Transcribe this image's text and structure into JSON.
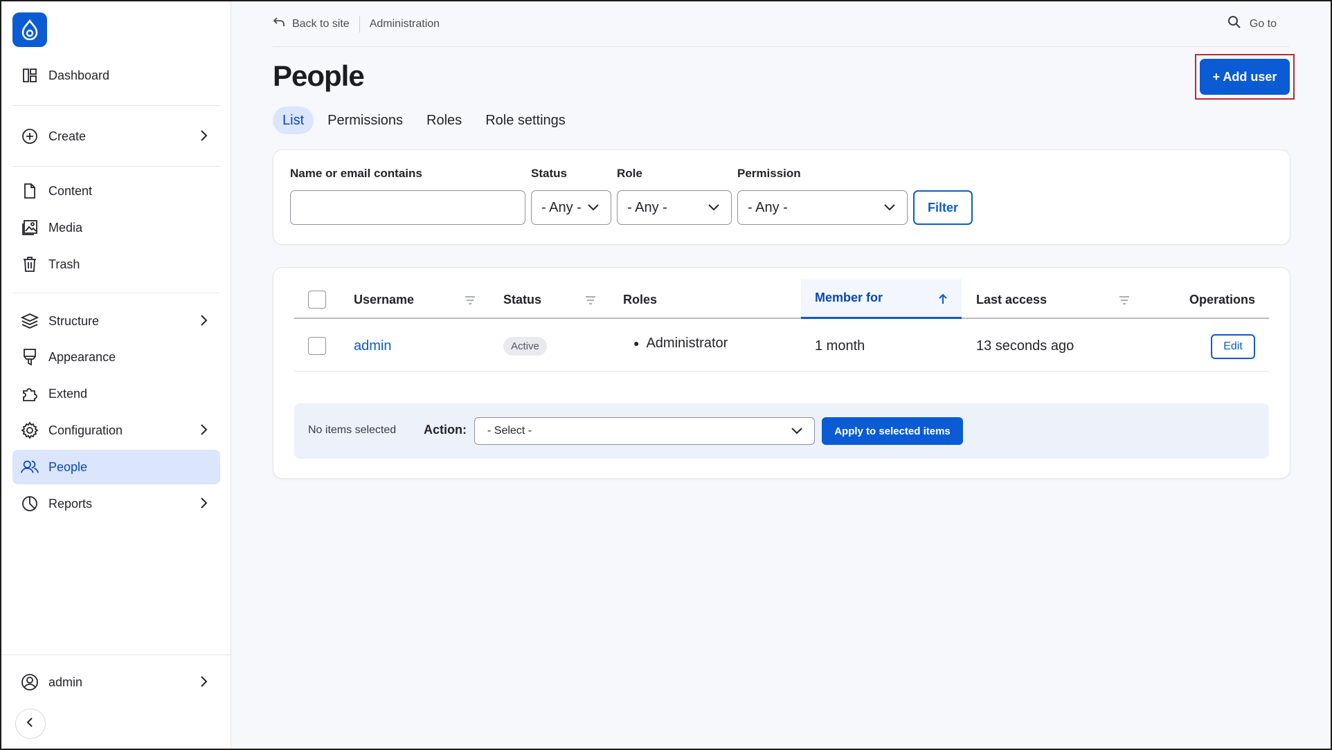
{
  "sidebar": {
    "logo_icon": "drupal-drop-icon",
    "items": [
      {
        "label": "Dashboard",
        "icon": "dashboard-icon"
      },
      {
        "label": "Create",
        "icon": "plus-circle-icon"
      },
      {
        "label": "Content",
        "icon": "file-icon"
      },
      {
        "label": "Media",
        "icon": "image-icon"
      },
      {
        "label": "Trash",
        "icon": "trash-icon"
      },
      {
        "label": "Structure",
        "icon": "layers-icon"
      },
      {
        "label": "Appearance",
        "icon": "brush-icon"
      },
      {
        "label": "Extend",
        "icon": "puzzle-icon"
      },
      {
        "label": "Configuration",
        "icon": "gear-icon"
      },
      {
        "label": "People",
        "icon": "users-icon"
      },
      {
        "label": "Reports",
        "icon": "pie-chart-icon"
      }
    ],
    "user": {
      "label": "admin",
      "icon": "user-circle-icon"
    }
  },
  "topbar": {
    "back_label": "Back to site",
    "breadcrumb": "Administration",
    "goto_label": "Go to"
  },
  "page": {
    "title": "People",
    "add_button": "+ Add user"
  },
  "tabs": [
    {
      "label": "List",
      "active": true
    },
    {
      "label": "Permissions"
    },
    {
      "label": "Roles"
    },
    {
      "label": "Role settings"
    }
  ],
  "filters": {
    "name_label": "Name or email contains",
    "name_value": "",
    "status_label": "Status",
    "status_value": "- Any -",
    "role_label": "Role",
    "role_value": "- Any -",
    "permission_label": "Permission",
    "permission_value": "- Any -",
    "filter_button": "Filter"
  },
  "table": {
    "columns": [
      "Username",
      "Status",
      "Roles",
      "Member for",
      "Last access",
      "Operations"
    ],
    "rows": [
      {
        "username": "admin",
        "status": "Active",
        "roles": "Administrator",
        "member_for": "1 month",
        "last_access": "13 seconds ago",
        "operation": "Edit"
      }
    ]
  },
  "bulk": {
    "selected_text": "No items selected",
    "action_label": "Action:",
    "action_value": "- Select -",
    "apply_button": "Apply to selected items"
  },
  "colors": {
    "accent": "#0a5bd4",
    "active_bg": "#dbe5fb",
    "highlight_border": "#c0272d"
  }
}
